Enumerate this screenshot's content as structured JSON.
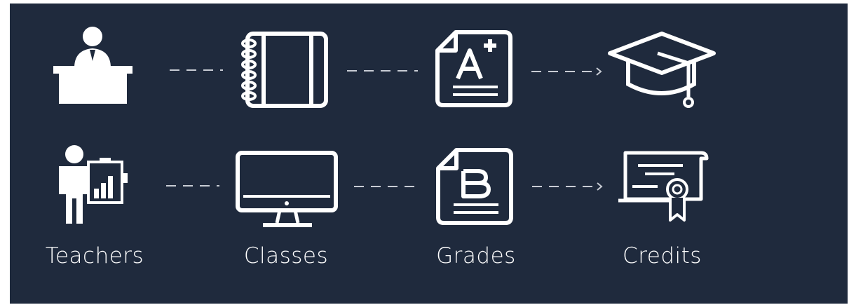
{
  "labels": {
    "teachers": "Teachers",
    "classes": "Classes",
    "grades": "Grades",
    "credits": "Credits"
  },
  "icons": {
    "row1": [
      "teacher-at-desk-icon",
      "notebook-icon",
      "grade-a-plus-document-icon",
      "graduation-cap-icon"
    ],
    "row2": [
      "teacher-with-chart-board-icon",
      "computer-monitor-icon",
      "grade-b-document-icon",
      "certificate-diploma-icon"
    ]
  },
  "colors": {
    "background": "#1f2a3d",
    "foreground": "#ffffff",
    "connector": "#c8ccd4"
  }
}
